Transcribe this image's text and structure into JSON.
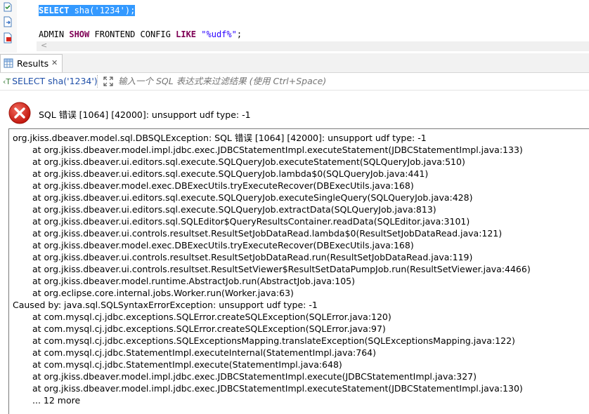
{
  "editor": {
    "line1": {
      "keyword": "SELECT",
      "text": " sha(",
      "string": "'1234'",
      "end": ");"
    },
    "line2": {
      "kw1": "ADMIN",
      "kw2": "SHOW",
      "mid": "FRONTEND",
      "mid2": "CONFIG",
      "kw3": "LIKE",
      "string": "\"%udf%\"",
      "end": ";"
    },
    "scroll_left": "<"
  },
  "results_tab": {
    "label": "Results",
    "close": "✕"
  },
  "filter_bar": {
    "query_prefix": "‹T",
    "query": "SELECT sha('1234')",
    "placeholder": "输入一个 SQL 表达式来过滤结果 (使用 Ctrl+Space)"
  },
  "error": {
    "title": "SQL 错误 [1064] [42000]: unsupport udf type: -1",
    "trace": [
      {
        "text": "org.jkiss.dbeaver.model.sql.DBSQLException: SQL 错误 [1064] [42000]: unsupport udf type: -1",
        "indent": false
      },
      {
        "text": "at org.jkiss.dbeaver.model.impl.jdbc.exec.JDBCStatementImpl.executeStatement(JDBCStatementImpl.java:133)",
        "indent": true
      },
      {
        "text": "at org.jkiss.dbeaver.ui.editors.sql.execute.SQLQueryJob.executeStatement(SQLQueryJob.java:510)",
        "indent": true
      },
      {
        "text": "at org.jkiss.dbeaver.ui.editors.sql.execute.SQLQueryJob.lambda$0(SQLQueryJob.java:441)",
        "indent": true
      },
      {
        "text": "at org.jkiss.dbeaver.model.exec.DBExecUtils.tryExecuteRecover(DBExecUtils.java:168)",
        "indent": true
      },
      {
        "text": "at org.jkiss.dbeaver.ui.editors.sql.execute.SQLQueryJob.executeSingleQuery(SQLQueryJob.java:428)",
        "indent": true
      },
      {
        "text": "at org.jkiss.dbeaver.ui.editors.sql.execute.SQLQueryJob.extractData(SQLQueryJob.java:813)",
        "indent": true
      },
      {
        "text": "at org.jkiss.dbeaver.ui.editors.sql.SQLEditor$QueryResultsContainer.readData(SQLEditor.java:3101)",
        "indent": true
      },
      {
        "text": "at org.jkiss.dbeaver.ui.controls.resultset.ResultSetJobDataRead.lambda$0(ResultSetJobDataRead.java:121)",
        "indent": true
      },
      {
        "text": "at org.jkiss.dbeaver.model.exec.DBExecUtils.tryExecuteRecover(DBExecUtils.java:168)",
        "indent": true
      },
      {
        "text": "at org.jkiss.dbeaver.ui.controls.resultset.ResultSetJobDataRead.run(ResultSetJobDataRead.java:119)",
        "indent": true
      },
      {
        "text": "at org.jkiss.dbeaver.ui.controls.resultset.ResultSetViewer$ResultSetDataPumpJob.run(ResultSetViewer.java:4466)",
        "indent": true
      },
      {
        "text": "at org.jkiss.dbeaver.model.runtime.AbstractJob.run(AbstractJob.java:105)",
        "indent": true
      },
      {
        "text": "at org.eclipse.core.internal.jobs.Worker.run(Worker.java:63)",
        "indent": true
      },
      {
        "text": "Caused by: java.sql.SQLSyntaxErrorException: unsupport udf type: -1",
        "indent": false
      },
      {
        "text": "at com.mysql.cj.jdbc.exceptions.SQLError.createSQLException(SQLError.java:120)",
        "indent": true
      },
      {
        "text": "at com.mysql.cj.jdbc.exceptions.SQLError.createSQLException(SQLError.java:97)",
        "indent": true
      },
      {
        "text": "at com.mysql.cj.jdbc.exceptions.SQLExceptionsMapping.translateException(SQLExceptionsMapping.java:122)",
        "indent": true
      },
      {
        "text": "at com.mysql.cj.jdbc.StatementImpl.executeInternal(StatementImpl.java:764)",
        "indent": true
      },
      {
        "text": "at com.mysql.cj.jdbc.StatementImpl.execute(StatementImpl.java:648)",
        "indent": true
      },
      {
        "text": "at org.jkiss.dbeaver.model.impl.jdbc.exec.JDBCStatementImpl.execute(JDBCStatementImpl.java:327)",
        "indent": true
      },
      {
        "text": "at org.jkiss.dbeaver.model.impl.jdbc.exec.JDBCStatementImpl.executeStatement(JDBCStatementImpl.java:130)",
        "indent": true
      },
      {
        "text": "... 12 more",
        "indent": true
      }
    ]
  },
  "colors": {
    "selection": "#3399ff",
    "keyword": "#7f0055",
    "string": "#2a00ff",
    "query_link": "#1f4fa8",
    "error_red": "#d9261c"
  }
}
